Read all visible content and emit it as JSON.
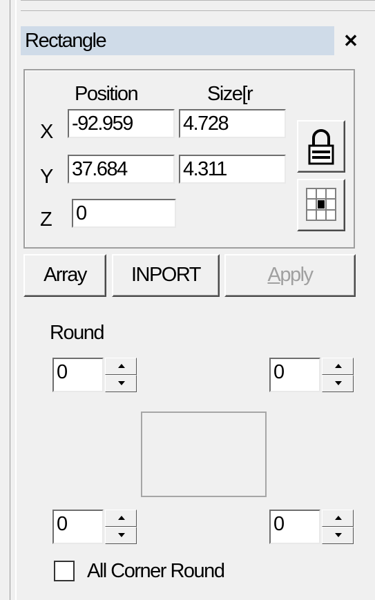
{
  "panel": {
    "title": "Rectangle",
    "close_icon": "close-icon"
  },
  "coords": {
    "position_header": "Position",
    "size_header": "Size[r",
    "x_label": "X",
    "y_label": "Y",
    "z_label": "Z",
    "x_position": "-92.959",
    "y_position": "37.684",
    "z_position": "0",
    "x_size": "4.728",
    "y_size": "4.311",
    "lock_icon": "lock-icon",
    "anchor_icon": "anchor-grid-icon"
  },
  "buttons": {
    "array": "Array",
    "import": "INPORT",
    "apply": "Apply"
  },
  "round": {
    "label": "Round",
    "top_left": "0",
    "top_right": "0",
    "bottom_left": "0",
    "bottom_right": "0"
  },
  "options": {
    "all_corner_round_label": "All Corner Round",
    "all_corner_round_checked": false
  }
}
